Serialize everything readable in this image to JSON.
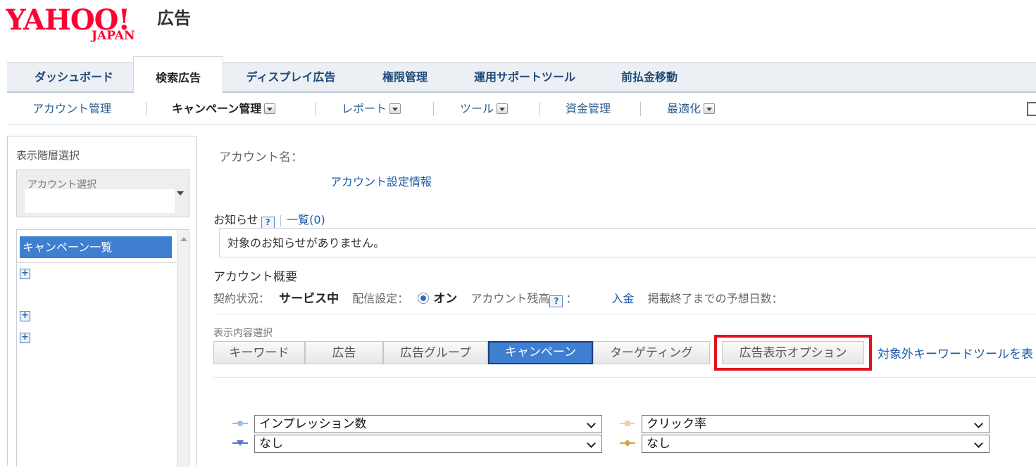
{
  "logo": {
    "brand_text": "YAHOO!",
    "sub_text": "JAPAN",
    "suffix": "広告"
  },
  "nav_primary": [
    {
      "label": "ダッシュボード"
    },
    {
      "label": "検索広告"
    },
    {
      "label": "ディスプレイ広告"
    },
    {
      "label": "権限管理"
    },
    {
      "label": "運用サポートツール"
    },
    {
      "label": "前払金移動"
    }
  ],
  "nav_secondary": [
    {
      "label": "アカウント管理"
    },
    {
      "label": "キャンペーン管理"
    },
    {
      "label": "レポート"
    },
    {
      "label": "ツール"
    },
    {
      "label": "資金管理"
    },
    {
      "label": "最適化"
    }
  ],
  "sidebar": {
    "title": "表示階層選択",
    "account_select_placeholder": "アカウント選択",
    "tree_header": "キャンペーン一覧"
  },
  "account": {
    "name_label": "アカウント名：",
    "settings_link": "アカウント設定情報"
  },
  "notice": {
    "label": "お知らせ",
    "help": "?",
    "list_link": "一覧(0)",
    "message": "対象のお知らせがありません。"
  },
  "overview": {
    "title": "アカウント概要",
    "contract_label": "契約状況：",
    "contract_value": "サービス中",
    "delivery_label": "配信設定：",
    "delivery_value": "オン",
    "balance_label": "アカウント残高",
    "help": "?",
    "colon": "：",
    "deposit_link": "入金",
    "days_label": "掲載終了までの予想日数："
  },
  "display": {
    "label": "表示内容選択",
    "tabs": [
      {
        "label": "キーワード"
      },
      {
        "label": "広告"
      },
      {
        "label": "広告グループ"
      },
      {
        "label": "キャンペーン"
      },
      {
        "label": "ターゲティング"
      }
    ],
    "ext_tab": "広告表示オプション",
    "kw_tool_link": "対象外キーワードツールを表"
  },
  "chart_selects": {
    "left1": "インプレッション数",
    "left2": "なし",
    "right1": "クリック率",
    "right2": "なし"
  },
  "colors": {
    "accent": "#3f7fd1",
    "link": "#1a5aa6",
    "highlight": "#e0131c",
    "logo_red": "#ff0033"
  }
}
